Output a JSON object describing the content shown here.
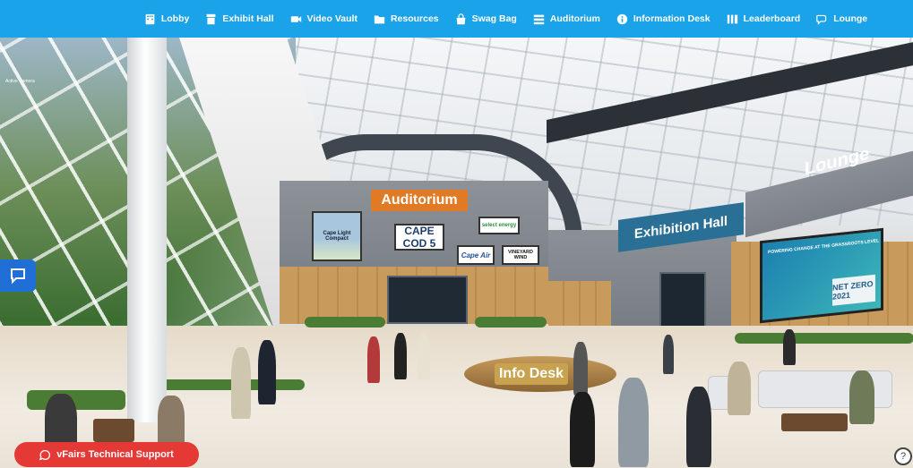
{
  "nav": {
    "items": [
      {
        "label": "Lobby",
        "icon": "building-icon"
      },
      {
        "label": "Exhibit Hall",
        "icon": "booth-icon"
      },
      {
        "label": "Video Vault",
        "icon": "video-camera-icon"
      },
      {
        "label": "Resources",
        "icon": "folder-icon"
      },
      {
        "label": "Swag Bag",
        "icon": "shopping-bag-icon"
      },
      {
        "label": "Auditorium",
        "icon": "list-icon"
      },
      {
        "label": "Information Desk",
        "icon": "info-icon"
      },
      {
        "label": "Leaderboard",
        "icon": "bar-chart-icon"
      },
      {
        "label": "Lounge",
        "icon": "chat-bubbles-icon"
      }
    ],
    "color": "#1aa3e8"
  },
  "scene": {
    "label": "Active Camera",
    "auditorium_sign": "Auditorium",
    "exhibition_sign": "Exhibition Hall",
    "lounge_sign": "Lounge",
    "info_desk_sign": "Info Desk",
    "posters": {
      "capelight": "Cape Light Compact",
      "capecod": "CAPE COD 5",
      "select": "select energy",
      "capeair": "Cape Air",
      "vineyard": "VINEYARD WIND"
    },
    "screen": {
      "headline": "POWERING CHANGE AT THE GRASSROOTS LEVEL",
      "netzero": "NET ZERO 2021"
    }
  },
  "support": {
    "label": "vFairs Technical Support",
    "color": "#e53935"
  },
  "help": {
    "label": "?"
  }
}
